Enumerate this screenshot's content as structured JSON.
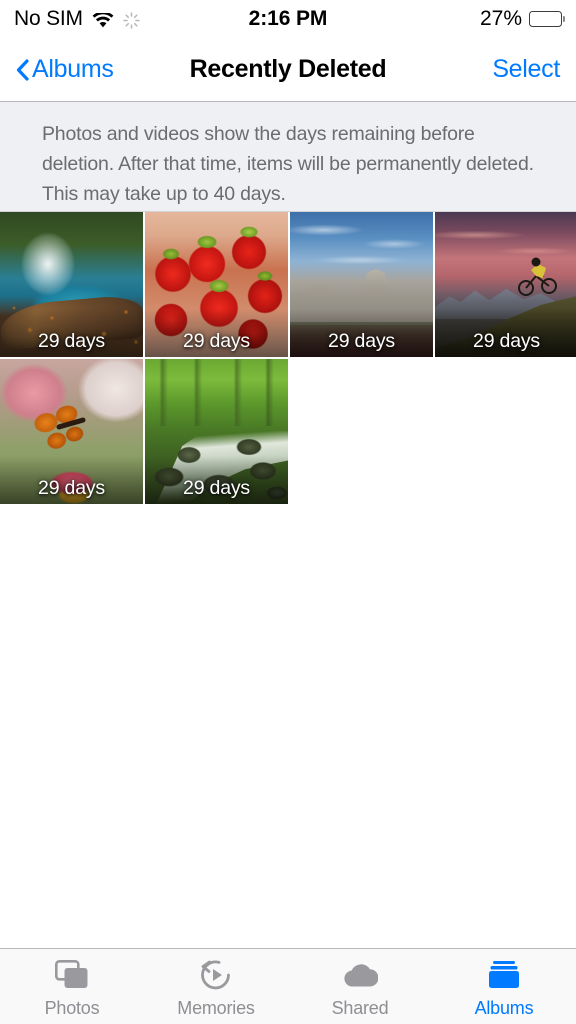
{
  "status_bar": {
    "carrier": "No SIM",
    "wifi_icon": "wifi-icon",
    "activity_icon": "activity-spinner-icon",
    "time": "2:16 PM",
    "battery_percent": "27%",
    "battery_level": 27,
    "battery_icon": "battery-icon"
  },
  "nav_bar": {
    "back_icon": "chevron-left-icon",
    "back_label": "Albums",
    "title": "Recently Deleted",
    "select_label": "Select"
  },
  "info_banner": {
    "text": "Photos and videos show the days remaining before deletion. After that time, items will be permanently deleted. This may take up to 40 days."
  },
  "photo_grid": {
    "items": [
      {
        "id": "photo-1",
        "days_label": "29 days",
        "subject": "waterfall-with-log-and-autumn-leaves",
        "art_class": "art-waterfall"
      },
      {
        "id": "photo-2",
        "days_label": "29 days",
        "subject": "strawberries-in-cupped-hands",
        "art_class": "art-berries"
      },
      {
        "id": "photo-3",
        "days_label": "29 days",
        "subject": "stone-cathedral-with-red-flowers",
        "art_class": "art-cathedral"
      },
      {
        "id": "photo-4",
        "days_label": "29 days",
        "subject": "mountain-biker-at-sunset",
        "art_class": "art-biker"
      },
      {
        "id": "photo-5",
        "days_label": "29 days",
        "subject": "monarch-butterfly-on-pink-flower",
        "art_class": "art-butterfly"
      },
      {
        "id": "photo-6",
        "days_label": "29 days",
        "subject": "forest-stream-with-mossy-rocks",
        "art_class": "art-stream"
      }
    ]
  },
  "tab_bar": {
    "active_index": 3,
    "active_color": "#007aff",
    "inactive_color": "#8e8e93",
    "tabs": [
      {
        "label": "Photos",
        "icon": "photos-stack-icon"
      },
      {
        "label": "Memories",
        "icon": "memories-play-circle-icon"
      },
      {
        "label": "Shared",
        "icon": "cloud-icon"
      },
      {
        "label": "Albums",
        "icon": "albums-stack-icon"
      }
    ]
  }
}
